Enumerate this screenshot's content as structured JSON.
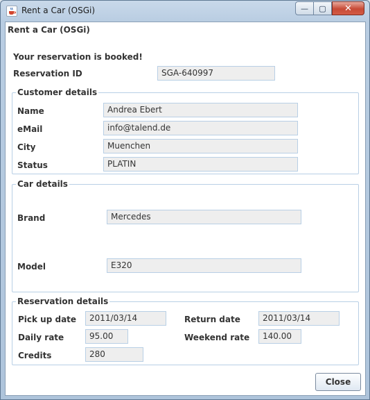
{
  "window": {
    "title": "Rent a Car (OSGi)",
    "min_glyph": "—",
    "max_glyph": "▢",
    "close_glyph": "✕"
  },
  "frame_title": "Rent a Car (OSGi)",
  "message": "Your reservation is booked!",
  "reservation": {
    "label": "Reservation ID",
    "value": "SGA-640997"
  },
  "customer": {
    "title": "Customer details",
    "name_label": "Name",
    "name_value": "Andrea Ebert",
    "email_label": "eMail",
    "email_value": "info@talend.de",
    "city_label": "City",
    "city_value": "Muenchen",
    "status_label": "Status",
    "status_value": "PLATIN"
  },
  "car": {
    "title": "Car details",
    "brand_label": "Brand",
    "brand_value": "Mercedes",
    "model_label": "Model",
    "model_value": "E320"
  },
  "details": {
    "title": "Reservation details",
    "pickup_label": "Pick up date",
    "pickup_value": "2011/03/14",
    "return_label": "Return date",
    "return_value": "2011/03/14",
    "daily_label": "Daily rate",
    "daily_value": "95.00",
    "weekend_label": "Weekend rate",
    "weekend_value": "140.00",
    "credits_label": "Credits",
    "credits_value": "280"
  },
  "close_button": "Close"
}
